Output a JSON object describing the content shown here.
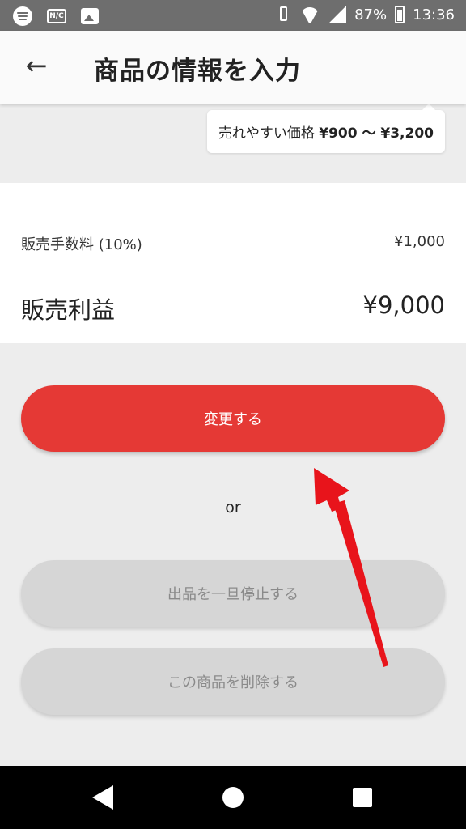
{
  "status_bar": {
    "battery": "87%",
    "time": "13:36",
    "icons": [
      "spotify-icon",
      "nfc-icon",
      "image-icon",
      "vibrate-icon",
      "wifi-icon",
      "signal-icon",
      "battery-icon"
    ],
    "nfc_label": "N/C"
  },
  "header": {
    "back_icon": "←",
    "title": "商品の情報を入力"
  },
  "price_hint": {
    "prefix": "売れやすい価格 ",
    "range": "¥900 〜 ¥3,200"
  },
  "summary": {
    "fee_label": "販売手数料 (10%)",
    "fee_value": "¥1,000",
    "profit_label": "販売利益",
    "profit_value": "¥9,000"
  },
  "actions": {
    "update_label": "変更する",
    "or_label": "or",
    "pause_label": "出品を一旦停止する",
    "delete_label": "この商品を削除する"
  },
  "colors": {
    "primary": "#e53935",
    "secondary": "#d6d6d6",
    "annotation": "#e8141b"
  },
  "nav_bar": {
    "icons": [
      "back-triangle-icon",
      "home-circle-icon",
      "recent-square-icon"
    ]
  }
}
